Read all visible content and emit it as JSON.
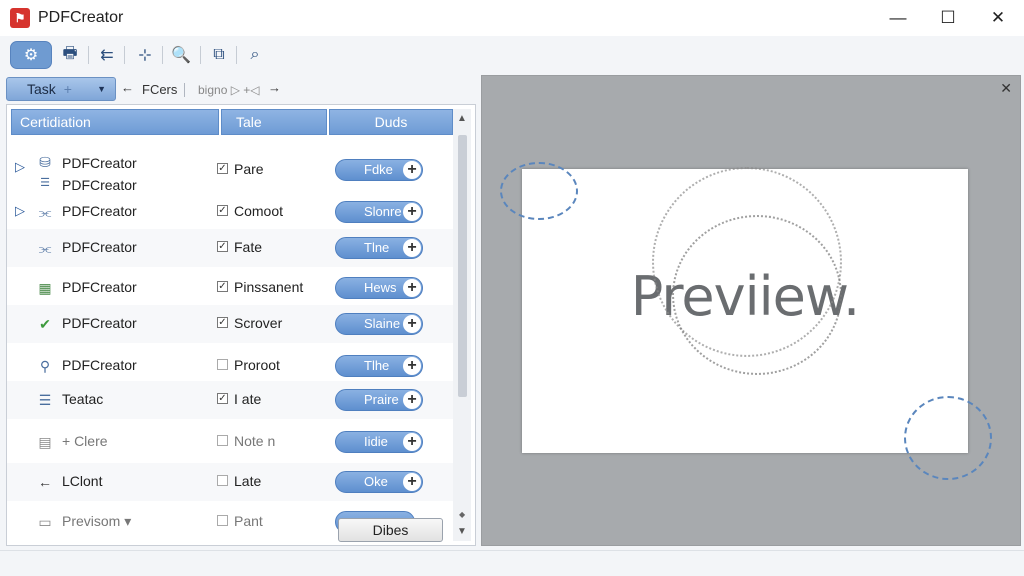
{
  "window": {
    "title": "PDFCreator",
    "controls": {
      "minimize": "—",
      "maximize": "☐",
      "close": "✕"
    }
  },
  "toolbar": {
    "buttons": [
      {
        "name": "settings-icon",
        "glyph": "⚙",
        "active": true
      },
      {
        "name": "printer-icon",
        "glyph": "🖶",
        "active": false
      },
      {
        "name": "back-arrows-icon",
        "glyph": "⇇",
        "active": false
      },
      {
        "name": "split-icon",
        "glyph": "⊹",
        "active": false
      },
      {
        "name": "zoom-icon",
        "glyph": "🔍",
        "active": false
      },
      {
        "name": "merge-icon",
        "glyph": "⧉",
        "active": false
      },
      {
        "name": "search-icon",
        "glyph": "⌕",
        "active": false
      }
    ]
  },
  "nav": {
    "task_label": "Task",
    "task_suffix": "+",
    "back": "←",
    "crumb1": "FCers",
    "crumb2": "bigno ▷ +◁",
    "forward": "→"
  },
  "list": {
    "columns": [
      "Certidiation",
      "Tale",
      "Duds"
    ],
    "rows": [
      {
        "expander": "▷",
        "icon": "database-icon",
        "glyph": "⛁",
        "name": "PDFCreator",
        "sub": "PDFCreator",
        "checked": true,
        "status": "Pare",
        "action": "Fdke"
      },
      {
        "expander": "▷",
        "icon": "chart-icon",
        "glyph": "⫘",
        "name": "PDFCreator",
        "checked": true,
        "status": "Comoot",
        "action": "Slonre"
      },
      {
        "expander": "",
        "icon": "chart-icon",
        "glyph": "⫘",
        "name": "PDFCreator",
        "checked": true,
        "status": "Fate",
        "action": "Tlne"
      },
      {
        "expander": "",
        "icon": "calculator-icon",
        "glyph": "▦",
        "name": "PDFCreator",
        "checked": true,
        "status": "Pinssanent",
        "action": "Hews"
      },
      {
        "expander": "",
        "icon": "checklist-icon",
        "glyph": "✔",
        "name": "PDFCreator",
        "checked": true,
        "status": "Scrover",
        "action": "Slaine"
      },
      {
        "expander": "",
        "icon": "link-icon",
        "glyph": "⚲",
        "name": "PDFCreator",
        "checked": false,
        "status": "Proroot",
        "action": "Tlhe"
      },
      {
        "expander": "",
        "icon": "list-icon",
        "glyph": "☰",
        "name": "Teatac",
        "checked": true,
        "status": "I ate",
        "action": "Praire"
      },
      {
        "expander": "",
        "icon": "document-icon",
        "glyph": "▤",
        "name": "+ Clere",
        "checked": false,
        "status": "Note n",
        "action": "Iidie",
        "muted": true
      },
      {
        "expander": "",
        "icon": "arrow-left-icon",
        "glyph": "←",
        "name": "LClont",
        "checked": false,
        "status": "Late",
        "action": "Oke"
      },
      {
        "expander": "",
        "icon": "folder-icon",
        "glyph": "▭",
        "name": "Previsom ▾",
        "checked": false,
        "status": "Pant",
        "action": "",
        "muted": true
      }
    ],
    "bottom_button": "Dibes"
  },
  "preview": {
    "close": "✕",
    "text": "Previiew."
  }
}
